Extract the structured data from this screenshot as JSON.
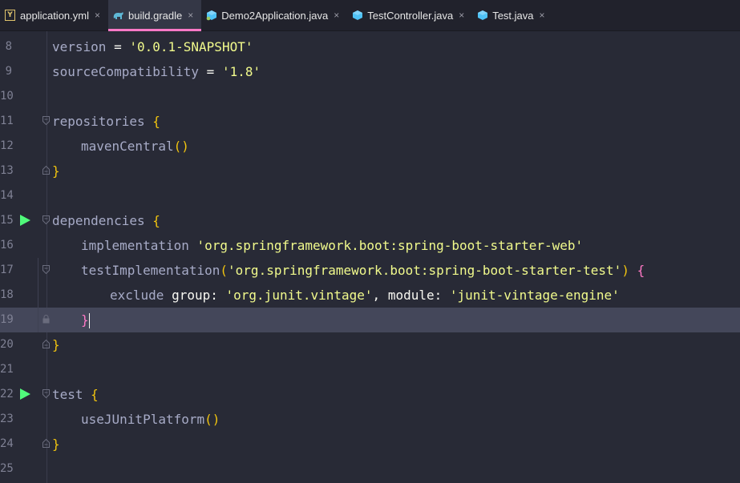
{
  "tabs": [
    {
      "label": "application.yml",
      "icon": "yaml-file-icon",
      "active": false
    },
    {
      "label": "build.gradle",
      "icon": "gradle-elephant-icon",
      "active": true
    },
    {
      "label": "Demo2Application.java",
      "icon": "java-class-icon",
      "active": false
    },
    {
      "label": "TestController.java",
      "icon": "java-class-icon",
      "active": false
    },
    {
      "label": "Test.java",
      "icon": "java-class-icon",
      "active": false
    }
  ],
  "yml_icon_letter": "Y",
  "close_glyph": "×",
  "lines": [
    {
      "num": "8"
    },
    {
      "num": "9"
    },
    {
      "num": "10"
    },
    {
      "num": "11"
    },
    {
      "num": "12"
    },
    {
      "num": "13"
    },
    {
      "num": "14"
    },
    {
      "num": "15"
    },
    {
      "num": "16"
    },
    {
      "num": "17"
    },
    {
      "num": "18"
    },
    {
      "num": "19"
    },
    {
      "num": "20"
    },
    {
      "num": "21"
    },
    {
      "num": "22"
    },
    {
      "num": "23"
    },
    {
      "num": "24"
    },
    {
      "num": "25"
    }
  ],
  "code": {
    "l8_key": "version",
    "l8_eq": " = ",
    "l8_val": "'0.0.1-SNAPSHOT'",
    "l9_key": "sourceCompatibility",
    "l9_eq": " = ",
    "l9_val": "'1.8'",
    "l11_key": "repositories",
    "l11_brace": " {",
    "l12_fn": "mavenCentral",
    "l12_paren": "()",
    "l13_brace": "}",
    "l15_key": "dependencies",
    "l15_brace": " {",
    "l16_fn": "implementation",
    "l16_val": "'org.springframework.boot:spring-boot-starter-web'",
    "l17_fn": "testImplementation",
    "l17_open": "(",
    "l17_val": "'org.springframework.boot:spring-boot-starter-test'",
    "l17_close": ")",
    "l17_brace": " {",
    "l18_fn": "exclude",
    "l18_group": "group",
    "l18_colon1": ": ",
    "l18_gval": "'org.junit.vintage'",
    "l18_comma": ", ",
    "l18_module": "module",
    "l18_colon2": ": ",
    "l18_mval": "'junit-vintage-engine'",
    "l19_brace": "}",
    "l20_brace": "}",
    "l22_key": "test",
    "l22_brace": " {",
    "l23_fn": "useJUnitPlatform",
    "l23_paren": "()",
    "l24_brace": "}"
  },
  "colors": {
    "background": "#282a36",
    "current_line": "#44475a",
    "active_tab_underline": "#ff79c6",
    "string": "#f1fa8c",
    "run_icon": "#50fa7b"
  }
}
